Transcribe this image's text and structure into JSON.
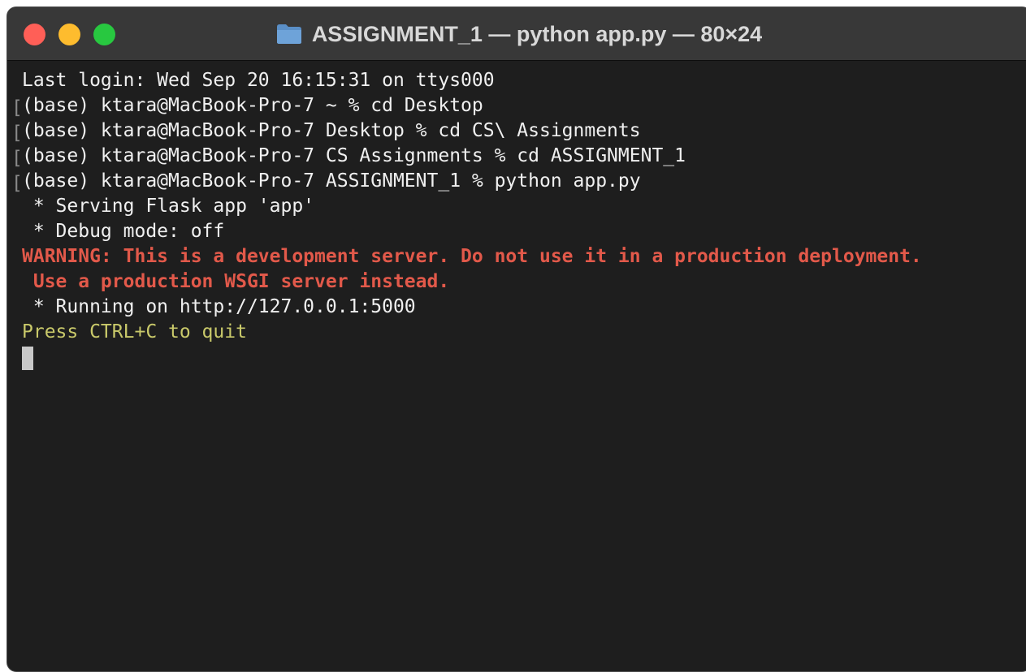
{
  "window": {
    "title": "ASSIGNMENT_1 — python app.py — 80×24",
    "title_icon": "folder-icon"
  },
  "traffic_lights": {
    "close_color": "#ff5f57",
    "minimize_color": "#febc2e",
    "maximize_color": "#28c840"
  },
  "terminal": {
    "lines": [
      {
        "text": "Last login: Wed Sep 20 16:15:31 on ttys000",
        "style": "normal",
        "bracket": false
      },
      {
        "text": "(base) ktara@MacBook-Pro-7 ~ % cd Desktop",
        "style": "normal",
        "bracket": true
      },
      {
        "text": "(base) ktara@MacBook-Pro-7 Desktop % cd CS\\ Assignments",
        "style": "normal",
        "bracket": true
      },
      {
        "text": "(base) ktara@MacBook-Pro-7 CS Assignments % cd ASSIGNMENT_1",
        "style": "normal",
        "bracket": true
      },
      {
        "text": "(base) ktara@MacBook-Pro-7 ASSIGNMENT_1 % python app.py",
        "style": "normal",
        "bracket": true
      },
      {
        "text": " * Serving Flask app 'app'",
        "style": "normal",
        "bracket": false
      },
      {
        "text": " * Debug mode: off",
        "style": "normal",
        "bracket": false
      },
      {
        "text": "WARNING: This is a development server. Do not use it in a production deployment.",
        "style": "warn",
        "bracket": false
      },
      {
        "text": " Use a production WSGI server instead.",
        "style": "warn",
        "bracket": false
      },
      {
        "text": " * Running on http://127.0.0.1:5000",
        "style": "normal",
        "bracket": false
      },
      {
        "text": "Press CTRL+C to quit",
        "style": "quit",
        "bracket": false
      }
    ],
    "colors": {
      "background": "#1e1e1e",
      "text": "#f0f0f0",
      "warning": "#e2594a",
      "quit": "#c9c96a"
    }
  }
}
